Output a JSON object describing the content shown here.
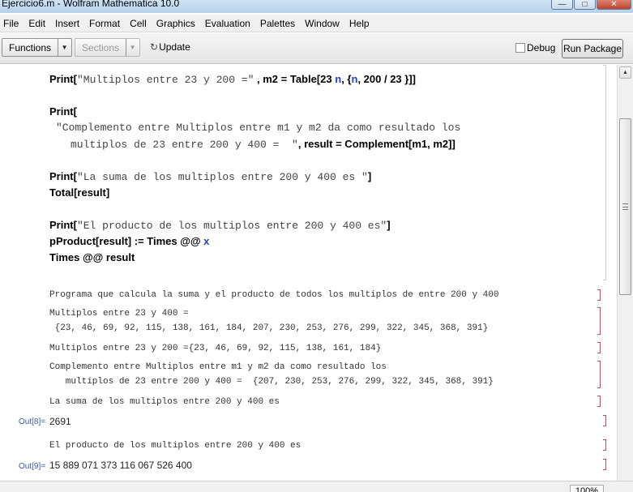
{
  "window": {
    "title": "Ejercicio6.m - Wolfram Mathematica 10.0",
    "controls": [
      "—",
      "□",
      "✕"
    ]
  },
  "menubar": {
    "items": [
      "File",
      "Edit",
      "Insert",
      "Format",
      "Cell",
      "Graphics",
      "Evaluation",
      "Palettes",
      "Window",
      "Help"
    ]
  },
  "toolbar": {
    "functions_label": "Functions",
    "sections_label": "Sections",
    "update_label": "Update",
    "debug_label": "Debug",
    "debug_checked": false,
    "run_package_label": "Run Package"
  },
  "code": {
    "l1_fn": "Print",
    "l1_open": "[",
    "l1_str": "\"Multiplos entre 23 y 200 =\"",
    "l1_rest_a": " , m2 = Table[23 ",
    "l1_var_n": "n",
    "l1_rest_b": ", {",
    "l1_var_n2": "n",
    "l1_rest_c": ", 200 / 23 }]]",
    "l2_fn": "Print[",
    "l3_str": "\"Complemento entre Multiplos entre m1 y m2 da como resultado los",
    "l4_str": "multiplos de 23 entre 200 y 400 =  \"",
    "l4_rest": ", result = Complement[m1, m2]]",
    "l5_fn": "Print[",
    "l5_str": "\"La suma de los multiplos entre 200 y 400 es \"",
    "l5_close": "]",
    "l6": "Total[result]",
    "l7_fn": "Print[",
    "l7_str": "\"El producto de los multiplos entre 200 y 400 es\"",
    "l7_close": "]",
    "l8_a": "pProduct[result] := Times @@ ",
    "l8_var": "x",
    "l9": "Times @@ result"
  },
  "output": {
    "o1": "Programa que calcula la suma y el producto de todos los multiplos de entre 200 y 400",
    "o2a": "Multiplos entre 23 y 400 =",
    "o2b": " {23, 46, 69, 92, 115, 138, 161, 184, 207, 230, 253, 276, 299, 322, 345, 368, 391}",
    "o3": "Multiplos entre 23 y 200 ={23, 46, 69, 92, 115, 138, 161, 184}",
    "o4a": "Complemento entre Multiplos entre m1 y m2 da como resultado los",
    "o4b": "   multiplos de 23 entre 200 y 400 =  {207, 230, 253, 276, 299, 322, 345, 368, 391}",
    "o5": "La suma de los multiplos entre 200 y 400 es",
    "out8_label": "Out[8]=",
    "out8_value": "2691",
    "o6": "El producto de los multiplos entre 200 y 400 es",
    "out9_label": "Out[9]=",
    "out9_value": "15 889 071 373 116 067 526 400"
  },
  "statusbar": {
    "zoom": "100%"
  }
}
